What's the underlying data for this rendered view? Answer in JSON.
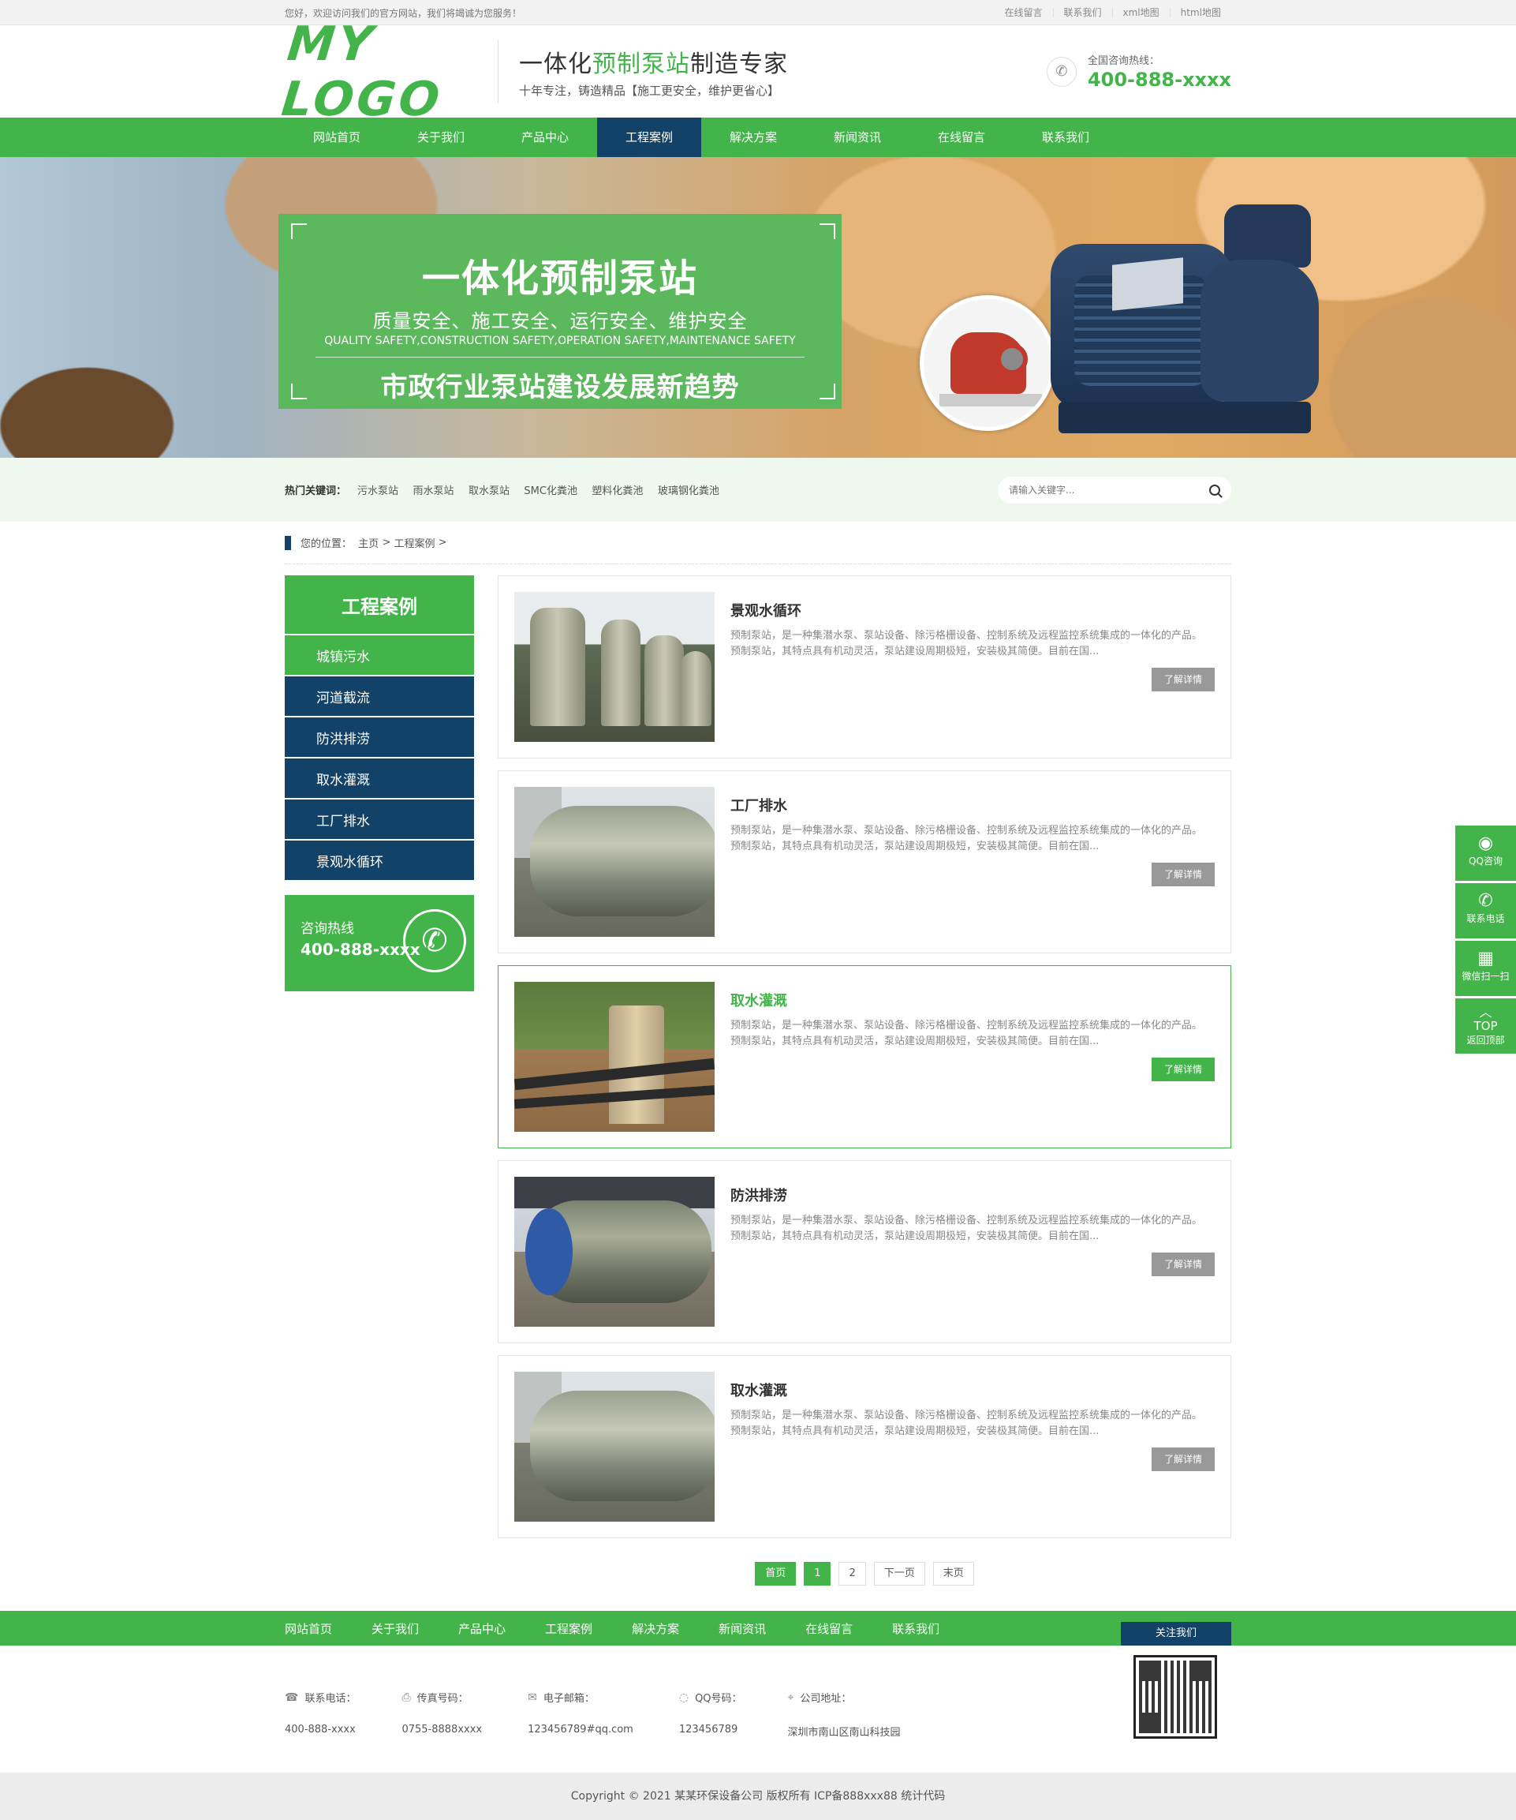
{
  "topbar": {
    "welcome": "您好，欢迎访问我们的官方网站，我们将竭诚为您服务！",
    "links": [
      "在线留言",
      "联系我们",
      "xml地图",
      "html地图"
    ]
  },
  "header": {
    "logo": "MY LOGO",
    "slogan_pre": "一体化",
    "slogan_em": "预制泵站",
    "slogan_post": "制造专家",
    "slogan_sub": "十年专注，铸造精品【施工更安全，维护更省心】",
    "hotline_label": "全国咨询热线：",
    "hotline_number": "400-888-xxxx"
  },
  "nav": [
    "网站首页",
    "关于我们",
    "产品中心",
    "工程案例",
    "解决方案",
    "新闻资讯",
    "在线留言",
    "联系我们"
  ],
  "nav_active": "工程案例",
  "banner": {
    "title": "一体化预制泵站",
    "subtitle": "质量安全、施工安全、运行安全、维护安全",
    "subtitle_en": "QUALITY SAFETY,CONSTRUCTION SAFETY,OPERATION SAFETY,MAINTENANCE SAFETY",
    "tagline": "市政行业泵站建设发展新趋势"
  },
  "keywords": {
    "label": "热门关键词：",
    "items": [
      "污水泵站",
      "雨水泵站",
      "取水泵站",
      "SMC化粪池",
      "塑料化粪池",
      "玻璃钢化粪池"
    ],
    "search_placeholder": "请输入关键字..."
  },
  "breadcrumb": {
    "label": "您的位置：",
    "home": "主页",
    "sep": ">",
    "current": "工程案例",
    "tail": ">"
  },
  "sidebar": {
    "title": "工程案例",
    "items": [
      "城镇污水",
      "河道截流",
      "防洪排涝",
      "取水灌溉",
      "工厂排水",
      "景观水循环"
    ],
    "contact_label": "咨询热线",
    "contact_number": "400-888-xxxx"
  },
  "cases": [
    {
      "title": "景观水循环",
      "desc": "预制泵站，是一种集潜水泵、泵站设备、除污格栅设备、控制系统及远程监控系统集成的一体化的产品。预制泵站，其特点具有机动灵活，泵站建设周期极短，安装极其简便。目前在国...",
      "more": "了解详情"
    },
    {
      "title": "工厂排水",
      "desc": "预制泵站，是一种集潜水泵、泵站设备、除污格栅设备、控制系统及远程监控系统集成的一体化的产品。预制泵站，其特点具有机动灵活，泵站建设周期极短，安装极其简便。目前在国...",
      "more": "了解详情"
    },
    {
      "title": "取水灌溉",
      "desc": "预制泵站，是一种集潜水泵、泵站设备、除污格栅设备、控制系统及远程监控系统集成的一体化的产品。预制泵站，其特点具有机动灵活，泵站建设周期极短，安装极其简便。目前在国...",
      "more": "了解详情"
    },
    {
      "title": "防洪排涝",
      "desc": "预制泵站，是一种集潜水泵、泵站设备、除污格栅设备、控制系统及远程监控系统集成的一体化的产品。预制泵站，其特点具有机动灵活，泵站建设周期极短，安装极其简便。目前在国...",
      "more": "了解详情"
    },
    {
      "title": "取水灌溉",
      "desc": "预制泵站，是一种集潜水泵、泵站设备、除污格栅设备、控制系统及远程监控系统集成的一体化的产品。预制泵站，其特点具有机动灵活，泵站建设周期极短，安装极其简便。目前在国...",
      "more": "了解详情"
    }
  ],
  "pager": [
    "首页",
    "1",
    "2",
    "下一页",
    "末页"
  ],
  "footer": {
    "nav": [
      "网站首页",
      "关于我们",
      "产品中心",
      "工程案例",
      "解决方案",
      "新闻资讯",
      "在线留言",
      "联系我们"
    ],
    "follow": "关注我们",
    "info": [
      {
        "label": "联系电话：",
        "value": "400-888-xxxx",
        "icon": "phone-icon"
      },
      {
        "label": "传真号码：",
        "value": "0755-8888xxxx",
        "icon": "fax-icon"
      },
      {
        "label": "电子邮箱：",
        "value": "123456789#qq.com",
        "icon": "mail-icon"
      },
      {
        "label": "QQ号码：",
        "value": "123456789",
        "icon": "qq-icon"
      },
      {
        "label": "公司地址：",
        "value": "深圳市南山区南山科技园",
        "icon": "location-icon"
      }
    ],
    "copyright": "Copyright © 2021 某某环保设备公司 版权所有  ICP备888xxx88  统计代码"
  },
  "float": [
    "QQ咨询",
    "联系电话",
    "微信扫一扫",
    "TOP",
    "返回顶部"
  ],
  "colors": {
    "primary": "#43b449",
    "dark": "#124268"
  }
}
